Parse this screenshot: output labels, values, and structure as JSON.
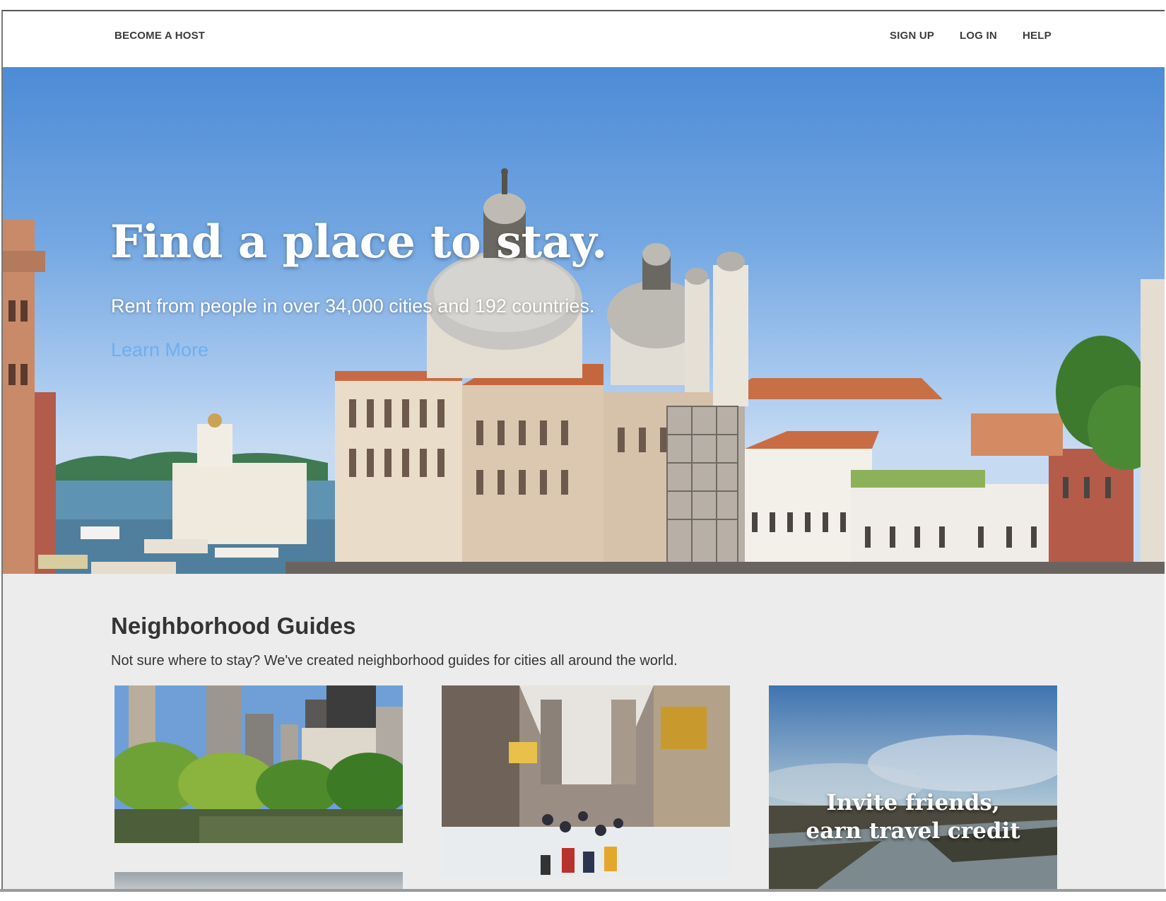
{
  "header": {
    "become_host": "BECOME A HOST",
    "sign_up": "SIGN UP",
    "log_in": "LOG IN",
    "help": "HELP"
  },
  "hero": {
    "title": "Find a place to stay.",
    "subtitle": "Rent from people in over 34,000 cities and 192 countries.",
    "link": "Learn More"
  },
  "guides": {
    "title": "Neighborhood Guides",
    "description": "Not sure where to stay? We've created neighborhood guides for cities all around the world.",
    "cards": [
      {
        "scene": "new-york-central-park"
      },
      {
        "scene": "snowy-shopping-street"
      },
      {
        "scene": "invite-friends-river",
        "line1": "Invite friends,",
        "line2": "earn travel credit"
      }
    ]
  },
  "colors": {
    "link": "#6eaef0",
    "header_bg": "#ffffff",
    "section_bg": "#ececec",
    "text": "#343434"
  }
}
